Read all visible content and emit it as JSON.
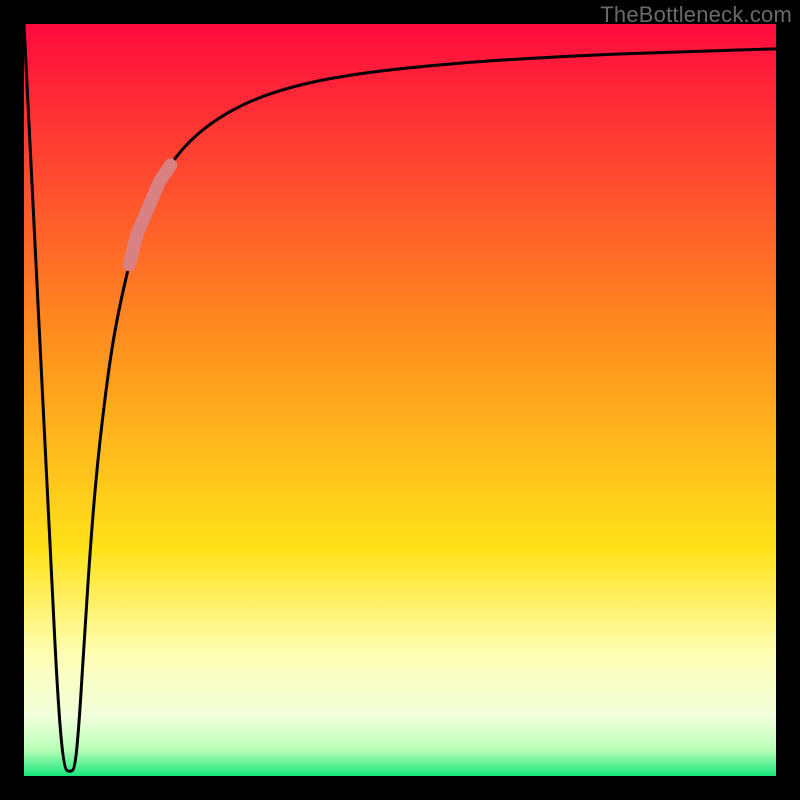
{
  "attribution": "TheBottleneck.com",
  "colors": {
    "frame": "#000000",
    "gradient_stops": [
      {
        "offset": 0.0,
        "color": "#ff0a3e"
      },
      {
        "offset": 0.42,
        "color": "#ff8f1f"
      },
      {
        "offset": 0.7,
        "color": "#ffe21a"
      },
      {
        "offset": 0.84,
        "color": "#feffb6"
      },
      {
        "offset": 0.92,
        "color": "#f3ffdc"
      },
      {
        "offset": 0.965,
        "color": "#b8ffb8"
      },
      {
        "offset": 1.0,
        "color": "#17e67a"
      }
    ],
    "curve": "#000000",
    "highlight": "#d98182"
  },
  "chart_data": {
    "type": "line",
    "title": "",
    "xlabel": "",
    "ylabel": "",
    "xlim": [
      0,
      100
    ],
    "ylim": [
      0,
      100
    ],
    "series": [
      {
        "name": "bottleneck-curve",
        "x": [
          0.0,
          1.5,
          3.5,
          4.5,
          5.3,
          6.1,
          6.8,
          7.4,
          8.0,
          9.0,
          10.0,
          11.5,
          13.0,
          15.0,
          18.0,
          21.0,
          25.0,
          30.0,
          36.0,
          43.0,
          52.0,
          63.0,
          76.0,
          90.0,
          100.0
        ],
        "y": [
          100.0,
          70.0,
          30.0,
          10.0,
          1.0,
          0.5,
          1.0,
          8.0,
          18.0,
          33.0,
          44.0,
          56.0,
          64.0,
          72.0,
          79.0,
          83.5,
          87.0,
          89.8,
          91.8,
          93.2,
          94.3,
          95.2,
          95.9,
          96.4,
          96.7
        ]
      }
    ],
    "highlight_segment": {
      "series": "bottleneck-curve",
      "x_range": [
        14.0,
        19.5
      ],
      "note": "thick salmon stroke over this interval"
    }
  }
}
